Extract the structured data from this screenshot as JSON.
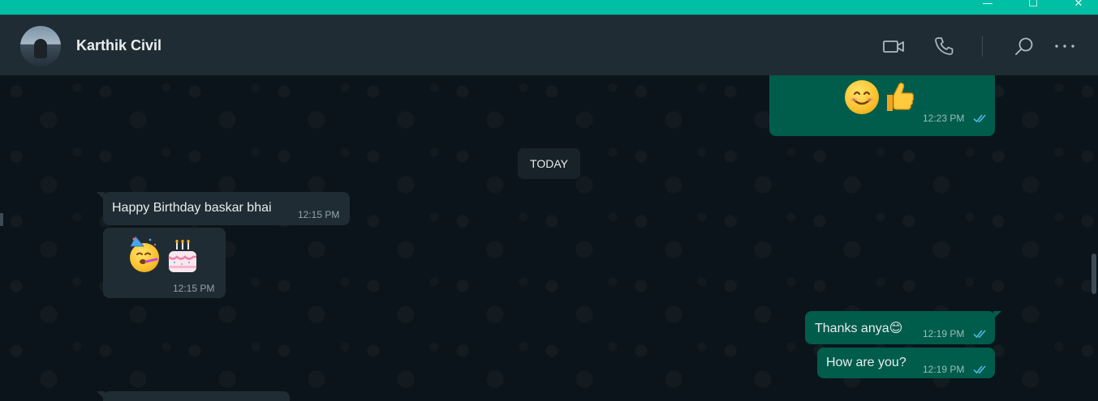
{
  "window": {
    "minimize_glyph": "—",
    "maximize_glyph": "☐",
    "close_glyph": "✕"
  },
  "header": {
    "contact_name": "Karthik Civil",
    "icons": [
      "video-call-icon",
      "voice-call-icon",
      "search-icon",
      "more-options-icon"
    ]
  },
  "chat": {
    "date_separator": "TODAY",
    "messages": [
      {
        "direction": "out",
        "kind": "emoji",
        "emoji": "😊👍",
        "time": "12:23 PM",
        "status": "read"
      },
      {
        "direction": "in",
        "kind": "text",
        "text": "Happy Birthday baskar bhai",
        "time": "12:15 PM"
      },
      {
        "direction": "in",
        "kind": "emoji",
        "emoji": "🥳🎂",
        "time": "12:15 PM"
      },
      {
        "direction": "out",
        "kind": "text",
        "text": "Thanks anya😊",
        "time": "12:19 PM",
        "status": "read"
      },
      {
        "direction": "out",
        "kind": "text",
        "text": "How are you?",
        "time": "12:19 PM",
        "status": "read"
      }
    ]
  },
  "colors": {
    "titlebar": "#00bfa5",
    "header_bg": "#202c33",
    "chat_bg": "#0b141a",
    "outgoing_bubble": "#005c4b",
    "incoming_bubble": "#202c33",
    "read_ticks": "#53bdeb"
  }
}
